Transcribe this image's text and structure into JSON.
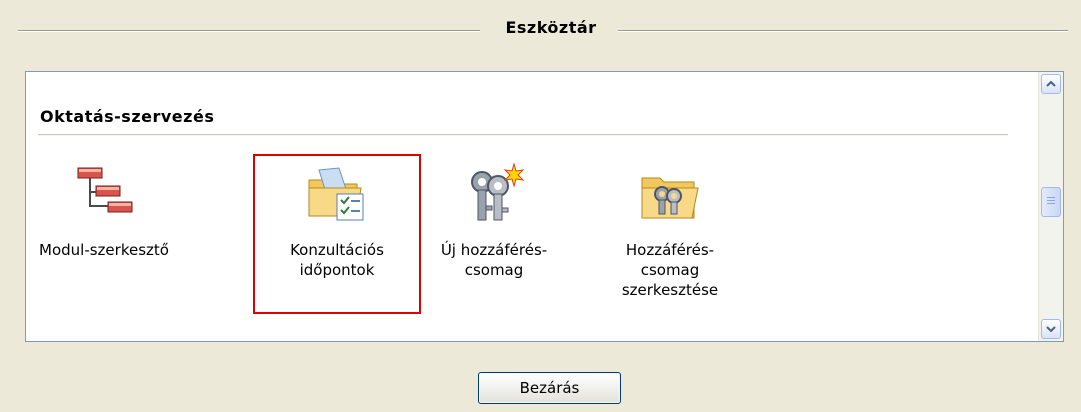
{
  "window": {
    "title": "Eszköztár"
  },
  "section": {
    "title": "Oktatás-szervezés"
  },
  "tools": [
    {
      "label": "Modul-szerkesztő",
      "icon": "module-editor-icon",
      "selected": false
    },
    {
      "label": "Konzultációs időpontok",
      "icon": "consultation-times-icon",
      "selected": true
    },
    {
      "label": "Új hozzáférés-csomag",
      "icon": "new-access-package-icon",
      "selected": false
    },
    {
      "label": "Hozzáférés-csomag szerkesztése",
      "icon": "edit-access-package-icon",
      "selected": false
    }
  ],
  "footer": {
    "close_label": "Bezárás"
  },
  "colors": {
    "selection_outline": "#e00000",
    "window_bg": "#ece9d8",
    "panel_border": "#7f9db9"
  }
}
